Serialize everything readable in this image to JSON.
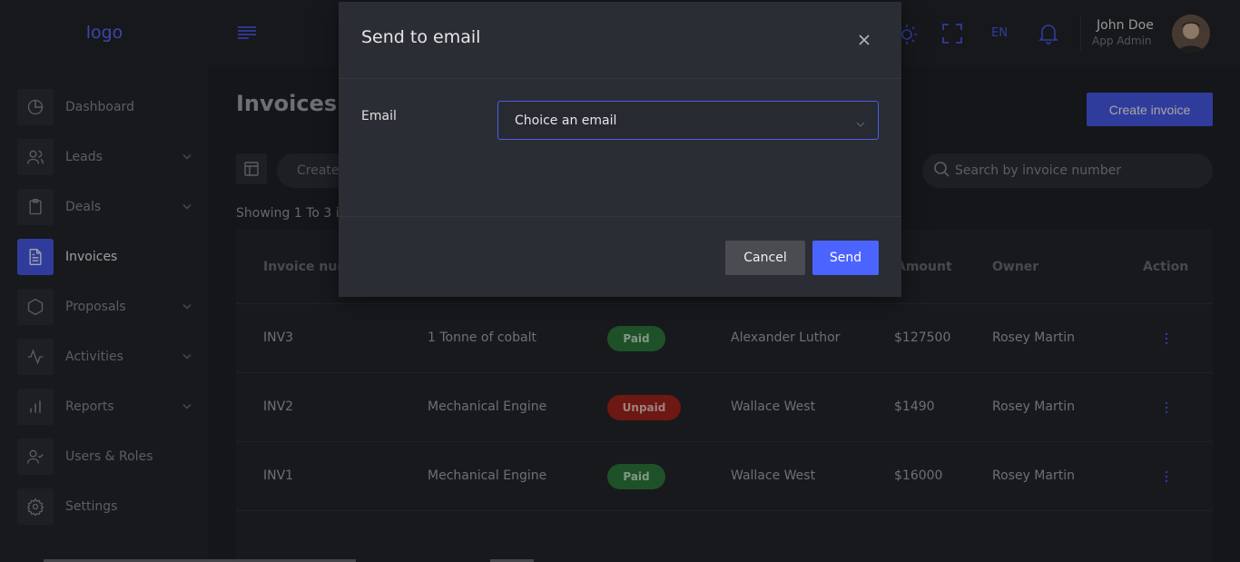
{
  "brand": {
    "logo_text": "logo"
  },
  "sidebar": {
    "items": [
      {
        "label": "Dashboard",
        "icon": "dashboard-icon",
        "has_chevron": false
      },
      {
        "label": "Leads",
        "icon": "users-icon",
        "has_chevron": true
      },
      {
        "label": "Deals",
        "icon": "clipboard-icon",
        "has_chevron": true
      },
      {
        "label": "Invoices",
        "icon": "invoice-icon",
        "has_chevron": false,
        "active": true
      },
      {
        "label": "Proposals",
        "icon": "hexagon-icon",
        "has_chevron": true
      },
      {
        "label": "Activities",
        "icon": "activity-icon",
        "has_chevron": true
      },
      {
        "label": "Reports",
        "icon": "bar-chart-icon",
        "has_chevron": true
      },
      {
        "label": "Users & Roles",
        "icon": "user-check-icon",
        "has_chevron": false
      },
      {
        "label": "Settings",
        "icon": "gear-icon",
        "has_chevron": false
      }
    ]
  },
  "topbar": {
    "language": "EN",
    "user_name": "John Doe",
    "user_role": "App Admin"
  },
  "page": {
    "title": "Invoices",
    "create_button": "Create invoice",
    "filter_pill": "Create",
    "search_placeholder": "Search by invoice number",
    "showing_text": "Showing 1 To 3 it"
  },
  "table": {
    "headers": [
      "Invoice num",
      "Amount",
      "Owner",
      "Action"
    ],
    "rows": [
      {
        "number": "INV3",
        "title": "1 Tonne of cobalt",
        "status": "Paid",
        "client": "Alexander Luthor",
        "amount": "$127500",
        "owner": "Rosey Martin"
      },
      {
        "number": "INV2",
        "title": "Mechanical Engine",
        "status": "Unpaid",
        "client": "Wallace West",
        "amount": "$1490",
        "owner": "Rosey Martin"
      },
      {
        "number": "INV1",
        "title": "Mechanical Engine",
        "status": "Paid",
        "client": "Wallace West",
        "amount": "$16000",
        "owner": "Rosey Martin"
      }
    ]
  },
  "modal": {
    "title": "Send to email",
    "email_label": "Email",
    "email_select_value": "Choice an email",
    "cancel_label": "Cancel",
    "send_label": "Send"
  },
  "colors": {
    "accent": "#4b5cf0",
    "paid": "#2f7d3e",
    "unpaid": "#a8261c",
    "background": "#202227"
  }
}
